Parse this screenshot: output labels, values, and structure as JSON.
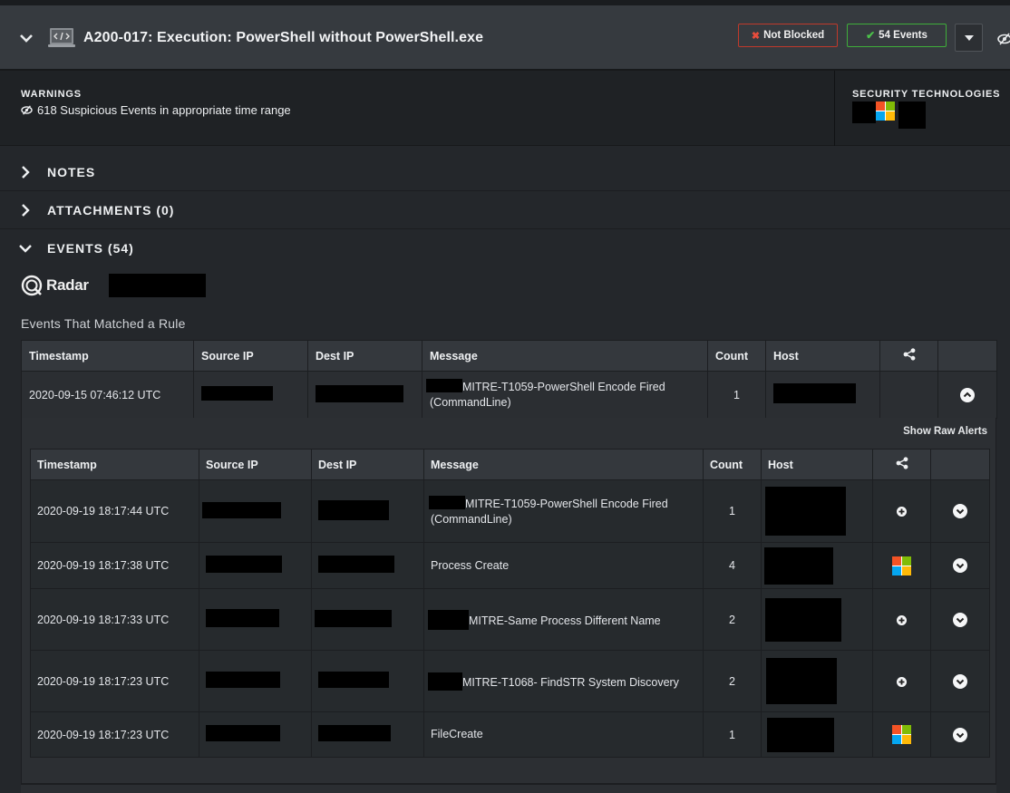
{
  "header": {
    "title": "A200-017: Execution: PowerShell without PowerShell.exe",
    "not_blocked": "Not Blocked",
    "events_badge": "54 Events"
  },
  "warnings": {
    "label": "WARNINGS",
    "text": "618 Suspicious Events in appropriate time range"
  },
  "security": {
    "label": "SECURITY TECHNOLOGIES"
  },
  "sections": {
    "notes": "NOTES",
    "attachments": "ATTACHMENTS (0)",
    "events": "EVENTS (54)"
  },
  "qradar_logo": "Radar",
  "events_title": "Events That Matched a Rule",
  "columns": [
    "Timestamp",
    "Source IP",
    "Dest IP",
    "Message",
    "Count",
    "Host"
  ],
  "outer_row": {
    "timestamp": "2020-09-15 07:46:12 UTC",
    "message": "MITRE-T1059-PowerShell Encode Fired (CommandLine)",
    "count": "1"
  },
  "show_raw": "Show Raw Alerts",
  "inner_rows": [
    {
      "timestamp": "2020-09-19 18:17:44 UTC",
      "message": "MITRE-T1059-PowerShell Encode Fired (CommandLine)",
      "count": "1",
      "icon": "plus"
    },
    {
      "timestamp": "2020-09-19 18:17:38 UTC",
      "message": "Process Create",
      "count": "4",
      "icon": "windows"
    },
    {
      "timestamp": "2020-09-19 18:17:33 UTC",
      "message": "MITRE-Same Process Different Name",
      "count": "2",
      "icon": "plus"
    },
    {
      "timestamp": "2020-09-19 18:17:23 UTC",
      "message": "MITRE-T1068- FindSTR System Discovery",
      "count": "2",
      "icon": "plus"
    },
    {
      "timestamp": "2020-09-19 18:17:23 UTC",
      "message": "FileCreate",
      "count": "1",
      "icon": "windows"
    }
  ],
  "colors": {
    "not_blocked": "#c0392b",
    "events": "#3fae3a",
    "header_bg": "#363a3f"
  }
}
